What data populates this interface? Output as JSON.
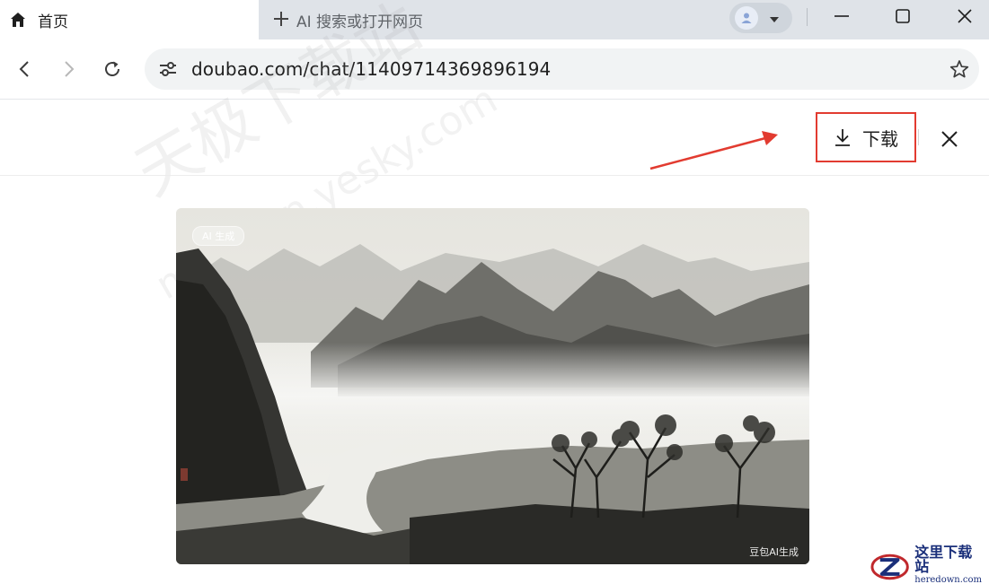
{
  "tab": {
    "title": "首页",
    "icon": "home-icon"
  },
  "new_tab": {
    "label": "AI 搜索或打开网页"
  },
  "profile": {
    "icon": "person-icon"
  },
  "window_controls": {
    "minimize": "minimize-icon",
    "maximize": "maximize-icon",
    "close": "close-icon"
  },
  "toolbar": {
    "back": "back-icon",
    "forward": "forward-icon",
    "reload": "reload-icon",
    "url": "doubao.com/chat/11409714369896194",
    "bookmark": "star-icon"
  },
  "viewer": {
    "download_label": "下载",
    "close_icon": "close-icon"
  },
  "image": {
    "ai_tag": "AI 生成",
    "ai_mark": "豆包AI生成",
    "description_icon": "landscape-painting"
  },
  "watermark": {
    "cn": "天极下载站",
    "en": "mydown.yesky.com"
  },
  "corner_logo": {
    "title": "这里下载站",
    "domain": "heredown.com"
  },
  "colors": {
    "annotation_red": "#e23b30",
    "tabstrip": "#dfe3e8",
    "omnibox": "#f1f3f4"
  }
}
